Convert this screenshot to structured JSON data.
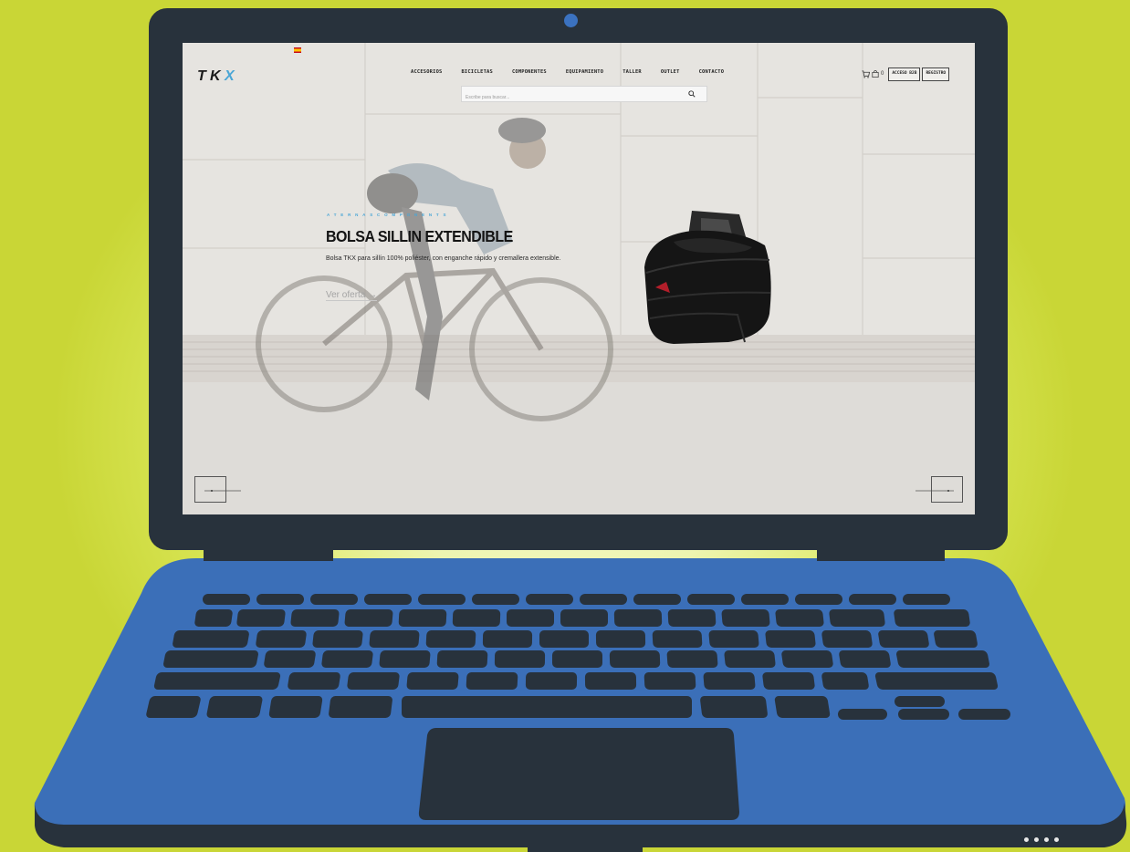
{
  "site": {
    "logo_text": "TKX",
    "language_flag": "es-flag-icon",
    "nav": [
      "ACCESORIOS",
      "BICICLETAS",
      "COMPONENTES",
      "EQUIPAMIENTO",
      "TALLER",
      "OUTLET",
      "CONTACTO"
    ],
    "search": {
      "placeholder": "Escribe para buscar..."
    },
    "cart": {
      "count": "0"
    },
    "header_buttons": {
      "login": "ACCESO B2B",
      "register": "REGISTRO"
    }
  },
  "hero": {
    "eyebrow": "ATERNASCOMPONENTS",
    "title": "BOLSA SILLIN EXTENDIBLE",
    "description": "Bolsa TKX para sillín 100% poliéster, con enganche rápido y cremallera extensible.",
    "link_label": "Ver oferta",
    "link_arrow": "→"
  },
  "colors": {
    "background": "#c9d636",
    "laptop_dark": "#28323c",
    "laptop_blue": "#3b6fb8",
    "accent": "#4aa6d6"
  }
}
